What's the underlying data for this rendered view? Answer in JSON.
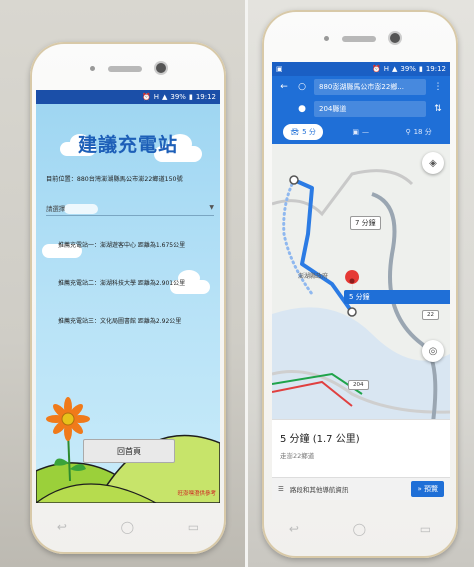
{
  "left": {
    "status": {
      "battery": "39%",
      "time": "19:12",
      "signal": "H"
    },
    "title": "建議充電站",
    "location": "目前位置：880台灣澎湖縣馬公市澎22鄉道150號",
    "select_label": "請選擇",
    "stations": [
      "推薦充電站一：澎湖遊客中心 距離為1.675公里",
      "推薦充電站二：澎湖科技大學 距離為2.901公里",
      "推薦充電站三：文化局圖書館 距離為2.92公里"
    ],
    "home_button": "回首頁",
    "credit": "旺澎嘿澄供參考"
  },
  "right": {
    "status": {
      "battery": "39%",
      "time": "19:12",
      "signal": "H"
    },
    "origin": "880澎湖縣馬公市澎22鄉...",
    "destination": "204縣道",
    "modes": [
      {
        "icon": "car-icon",
        "label": "5 分"
      },
      {
        "icon": "transit-icon",
        "label": "—"
      },
      {
        "icon": "walk-icon",
        "label": "18 分"
      }
    ],
    "map_labels": {
      "alt_route": "7 分鐘",
      "selected_route": "5 分鐘",
      "place": "澎湖縣政府",
      "road_a": "204",
      "road_b": "22"
    },
    "eta": "5 分鐘 (1.7 公里)",
    "via": "走澎22鄉道",
    "steps_label": "路段和其他導航資訊",
    "preview_button": "預覽",
    "colors": {
      "accent": "#1f6fd7",
      "route": "#2b7be4"
    }
  }
}
